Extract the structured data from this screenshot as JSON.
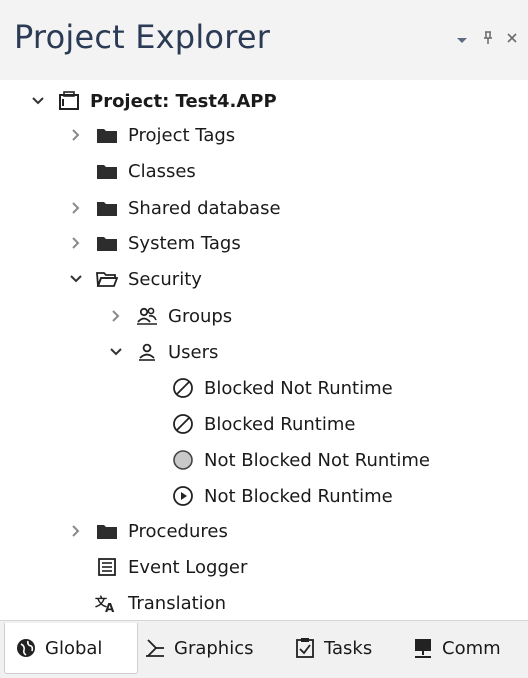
{
  "panel": {
    "title": "Project Explorer",
    "dropdown_icon": "chevron-down-icon",
    "pin_icon": "pin-icon",
    "close_icon": "close-icon"
  },
  "tree": {
    "root": "Project: Test4.APP",
    "project_tags": "Project Tags",
    "classes": "Classes",
    "shared_database": "Shared database",
    "system_tags": "System Tags",
    "security": "Security",
    "groups": "Groups",
    "users": "Users",
    "user_blocked_not_runtime": "Blocked Not Runtime",
    "user_blocked_runtime": "Blocked Runtime",
    "user_not_blocked_not_runtime": "Not Blocked Not Runtime",
    "user_not_blocked_runtime": "Not Blocked Runtime",
    "procedures": "Procedures",
    "event_logger": "Event Logger",
    "translation": "Translation"
  },
  "tabs": {
    "global": "Global",
    "graphics": "Graphics",
    "tasks": "Tasks",
    "comm": "Comm"
  }
}
